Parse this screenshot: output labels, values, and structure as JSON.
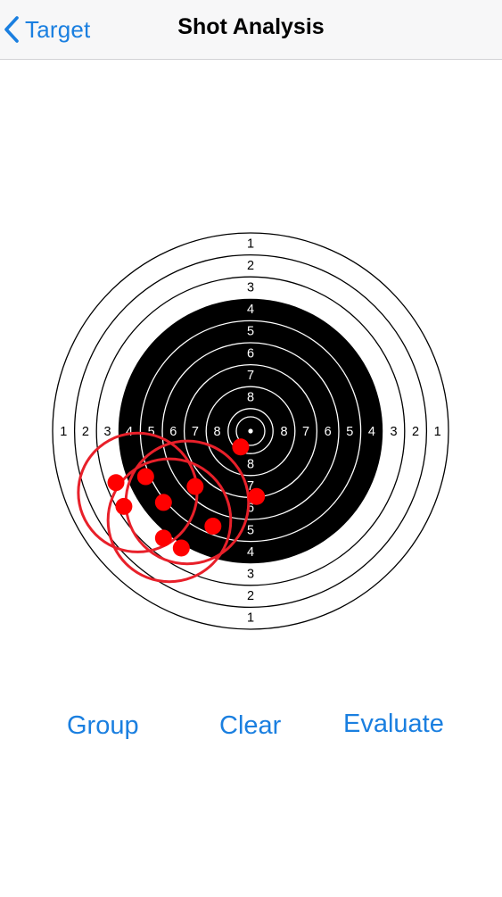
{
  "navbar": {
    "back_label": "Target",
    "back_icon": "chevron-left-icon",
    "title": "Shot Analysis"
  },
  "target": {
    "horizontal_labels": [
      "1",
      "2",
      "3",
      "4",
      "5",
      "6",
      "7",
      "8",
      "8",
      "7",
      "6",
      "5",
      "4",
      "3",
      "2",
      "1"
    ],
    "top_labels": [
      "1",
      "2",
      "3",
      "4",
      "5",
      "6",
      "7",
      "8"
    ],
    "bottom_labels": [
      "8",
      "7",
      "6",
      "5",
      "4",
      "3",
      "2",
      "1"
    ],
    "shots": [
      {
        "dx": -0.05,
        "dy": 0.08
      },
      {
        "dx": 0.03,
        "dy": 0.33
      },
      {
        "dx": -0.68,
        "dy": 0.26
      },
      {
        "dx": -0.53,
        "dy": 0.23
      },
      {
        "dx": -0.64,
        "dy": 0.38
      },
      {
        "dx": -0.44,
        "dy": 0.36
      },
      {
        "dx": -0.28,
        "dy": 0.28
      },
      {
        "dx": -0.44,
        "dy": 0.54
      },
      {
        "dx": -0.35,
        "dy": 0.59
      },
      {
        "dx": -0.19,
        "dy": 0.48
      }
    ],
    "groups": [
      {
        "cx": -0.57,
        "cy": 0.31,
        "r": 0.3
      },
      {
        "cx": -0.41,
        "cy": 0.45,
        "r": 0.31
      },
      {
        "cx": -0.32,
        "cy": 0.36,
        "r": 0.31
      }
    ],
    "colors": {
      "black_area": "#000000",
      "ring_line": "#000000",
      "shot": "#ff0000",
      "group_ring": "#e8202a"
    }
  },
  "toolbar": {
    "group_label": "Group",
    "clear_label": "Clear",
    "evaluate_label": "Evaluate"
  },
  "colors": {
    "accent": "#1a7fe0",
    "navbar_bg": "#f7f7f8"
  }
}
